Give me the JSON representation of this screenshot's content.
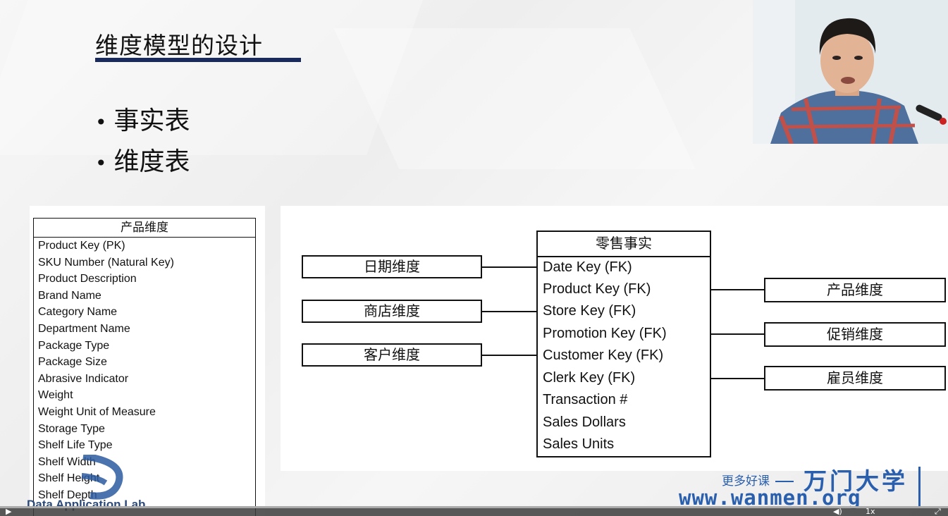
{
  "slide": {
    "title": "维度模型的设计",
    "bullets": [
      "事实表",
      "维度表"
    ]
  },
  "product_dimension": {
    "header": "产品维度",
    "attributes": [
      "Product Key (PK)",
      "SKU Number (Natural Key)",
      "Product Description",
      "Brand Name",
      "Category Name",
      "Department Name",
      "Package Type",
      "Package Size",
      "Abrasive Indicator",
      "Weight",
      "Weight Unit of Measure",
      "Storage Type",
      "Shelf Life Type",
      "Shelf Width",
      "Shelf Height",
      "Shelf Depth"
    ]
  },
  "star_schema": {
    "fact": {
      "header": "零售事实",
      "fields": [
        "Date Key (FK)",
        "Product Key (FK)",
        "Store Key (FK)",
        "Promotion Key (FK)",
        "Customer Key (FK)",
        "Clerk Key (FK)",
        "Transaction #",
        "Sales Dollars",
        "Sales Units"
      ]
    },
    "left_dimensions": [
      "日期维度",
      "商店维度",
      "客户维度"
    ],
    "right_dimensions": [
      "产品维度",
      "促销维度",
      "雇员维度"
    ]
  },
  "branding": {
    "lab_name": "Data Application Lab",
    "promo_text": "更多好课",
    "school_name": "万门大学",
    "url": "www.wanmen.org",
    "accent_color": "#2a5fae"
  },
  "player": {
    "play_icon": "play-icon",
    "volume_icon": "volume-icon",
    "speed_label": "1x",
    "fullscreen_icon": "fullscreen-icon"
  }
}
